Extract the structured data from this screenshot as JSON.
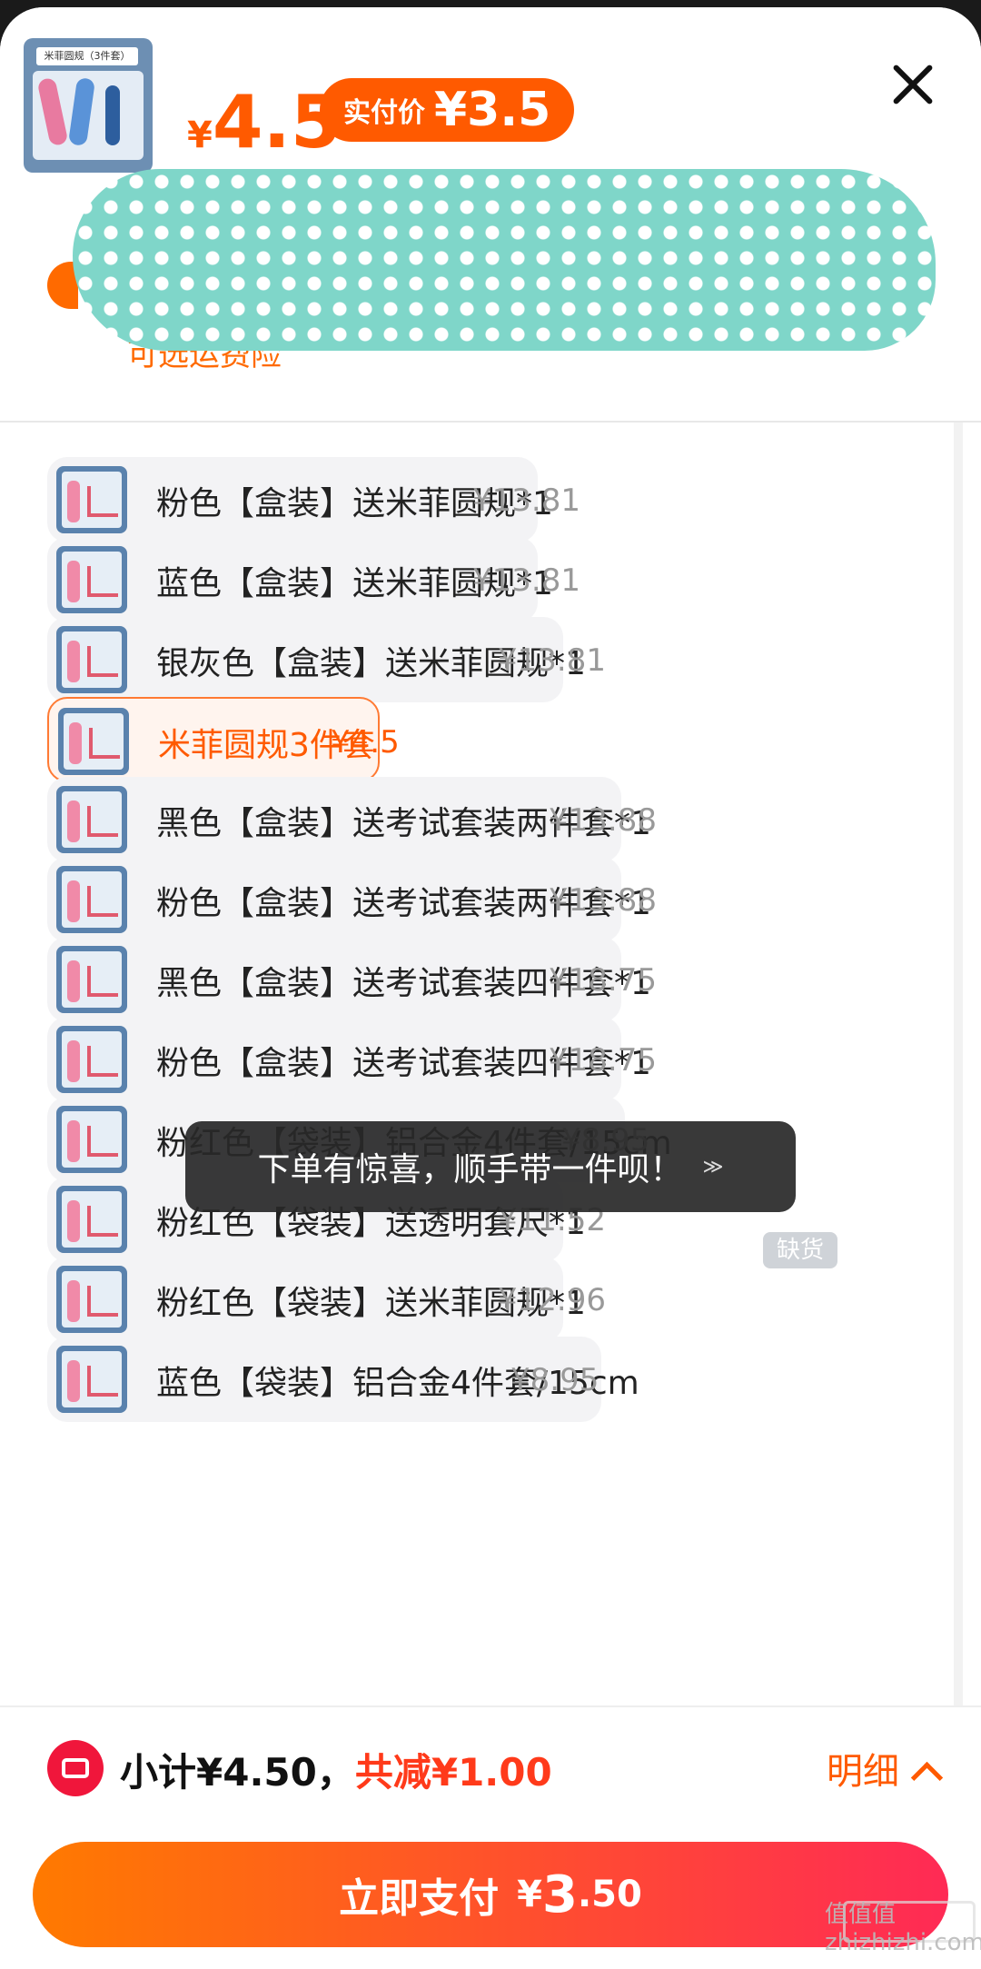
{
  "header": {
    "thumb_tag": "米菲圆规（3件套）",
    "price_yen": "¥",
    "price_value": "4.5",
    "actual_label": "实付价",
    "actual_yen_value": "¥3.5",
    "insurance_text": "可选运费险"
  },
  "items": [
    {
      "name": "粉色【盒装】送米菲圆规*1",
      "price": "¥13.81",
      "selected": false
    },
    {
      "name": "蓝色【盒装】送米菲圆规*1",
      "price": "¥13.81",
      "selected": false
    },
    {
      "name": "银灰色【盒装】送米菲圆规*1",
      "price": "¥13.81",
      "selected": false
    },
    {
      "name": "米菲圆规3件套",
      "price": "¥4.5",
      "selected": true
    },
    {
      "name": "黑色【盒装】送考试套装两件套*1",
      "price": "¥13.88",
      "selected": false
    },
    {
      "name": "粉色【盒装】送考试套装两件套*1",
      "price": "¥13.88",
      "selected": false
    },
    {
      "name": "黑色【盒装】送考试套装四件套*1",
      "price": "¥18.75",
      "selected": false
    },
    {
      "name": "粉色【盒装】送考试套装四件套*1",
      "price": "¥18.75",
      "selected": false
    },
    {
      "name": "粉红色【袋装】铝合金4件套/15cm",
      "price": "¥8.95",
      "selected": false
    },
    {
      "name": "粉红色【袋装】送透明套尺*1",
      "price": "¥11.52",
      "selected": false
    },
    {
      "name": "粉红色【袋装】送米菲圆规*1",
      "price": "¥12.96",
      "selected": false
    },
    {
      "name": "蓝色【袋装】铝合金4件套/15cm",
      "price": "¥8.95",
      "selected": false
    }
  ],
  "toast": {
    "text": "下单有惊喜，顺手带一件呗！",
    "chevron": "≫"
  },
  "out_of_stock_label": "缺货",
  "footer": {
    "subtotal_label": "小计¥4.50，",
    "discount_label": "共减¥1.00",
    "detail_label": "明细",
    "pay_label": "立即支付",
    "pay_yen": "¥",
    "pay_int": "3",
    "pay_dec": ".50"
  },
  "watermark": "值值值 zhizhizhi.com",
  "colors": {
    "accent": "#ff5a00",
    "discount": "#ff3a1a",
    "pay_gradient_end": "#ff2a55"
  }
}
